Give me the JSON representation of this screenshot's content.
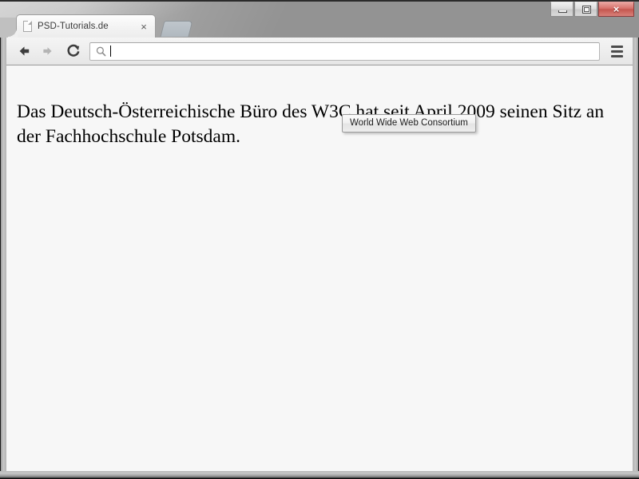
{
  "window": {
    "controls": {
      "minimize_label": "Minimize",
      "maximize_label": "Maximize",
      "close_label": "×"
    }
  },
  "tabs": [
    {
      "title": "PSD-Tutorials.de",
      "favicon": "page-icon",
      "close_label": "×",
      "active": true
    }
  ],
  "new_tab": {
    "label": "New Tab"
  },
  "toolbar": {
    "back_label": "Back",
    "forward_label": "Forward",
    "reload_label": "Reload",
    "menu_label": "Menu",
    "omnibox": {
      "value": "",
      "placeholder": "",
      "icon": "search-icon"
    }
  },
  "page": {
    "paragraph": "Das Deutsch-Österreichische Büro des W3C hat seit April 2009 seinen Sitz an der Fachhochschule Potsdam."
  },
  "tooltip": {
    "text": "World Wide Web Consortium",
    "visible": true
  },
  "colors": {
    "title_bar": "#939393",
    "toolbar": "#ededed",
    "page_background": "#f7f7f7",
    "close_button": "#c4564f",
    "text": "#000000",
    "tooltip_border": "#9b9b9b"
  }
}
